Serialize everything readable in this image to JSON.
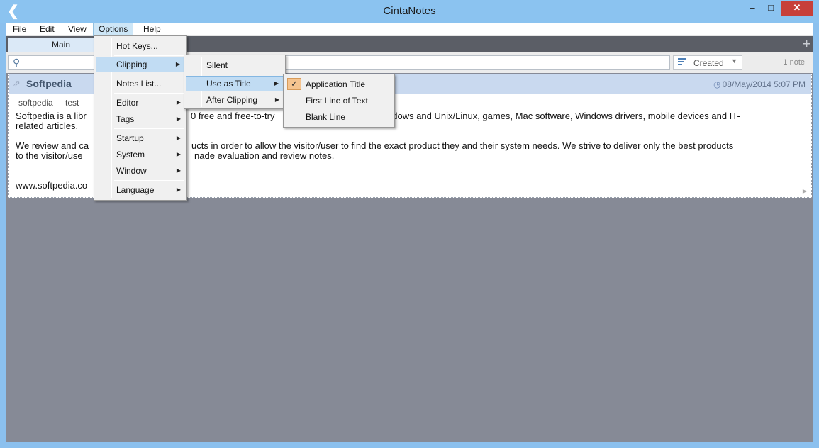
{
  "window": {
    "title": "CintaNotes",
    "minimize": "–",
    "maximize": "□",
    "close": "✕"
  },
  "menubar": {
    "file": "File",
    "edit": "Edit",
    "view": "View",
    "options": "Options",
    "help": "Help"
  },
  "tabs": {
    "main": "Main",
    "add": "+"
  },
  "search": {
    "placeholder": "",
    "sort_label": "Created",
    "note_count": "1 note"
  },
  "note": {
    "title": "Softpedia",
    "date": "08/May/2014 5:07 PM",
    "tags": [
      "softpedia",
      "test"
    ],
    "paragraph1": "Softpedia is a libr… 0 free and free-to-try … indows and Unix/Linux, games, Mac software, Windows drivers, mobile devices and IT-related articles.",
    "paragraph1_left": "Softpedia is a libr",
    "paragraph1_mid": "0 free and free-to-try",
    "paragraph1_right": "ndows and Unix/Linux, games, Mac software, Windows drivers, mobile devices and IT-",
    "paragraph1_line2": "related articles.",
    "paragraph2_left": "We review and ca",
    "paragraph2_right": "ucts in order to allow the visitor/user to find the exact product they and their system needs. We strive to deliver only the best products",
    "paragraph2_line2_left": "to the visitor/use",
    "paragraph2_line2_right": "nade evaluation and review notes.",
    "footer_text": "www.softpedia.co"
  },
  "options_menu": {
    "hotkeys": "Hot Keys...",
    "clipping": "Clipping",
    "notes_list": "Notes List...",
    "editor": "Editor",
    "tags": "Tags",
    "startup": "Startup",
    "system": "System",
    "window": "Window",
    "language": "Language"
  },
  "clipping_menu": {
    "silent": "Silent",
    "use_as_title": "Use as Title",
    "after_clipping": "After Clipping"
  },
  "title_menu": {
    "application_title": "Application Title",
    "first_line": "First Line of Text",
    "blank_line": "Blank Line",
    "checked": "application_title"
  },
  "icons": {
    "app": "back-arrow-icon",
    "search": "search-icon",
    "sort": "sort-icon",
    "pin": "pin-icon",
    "clock": "clock-icon",
    "check": "checkmark-icon",
    "submenu": "triangle-right-icon"
  },
  "colors": {
    "title_bar": "#8bc3f0",
    "client_bg": "#868a96",
    "note_header": "#c9d9ef",
    "menu_highlight": "#c1dcf3",
    "close_button": "#c7403a",
    "check_bg": "#f5c48f"
  }
}
